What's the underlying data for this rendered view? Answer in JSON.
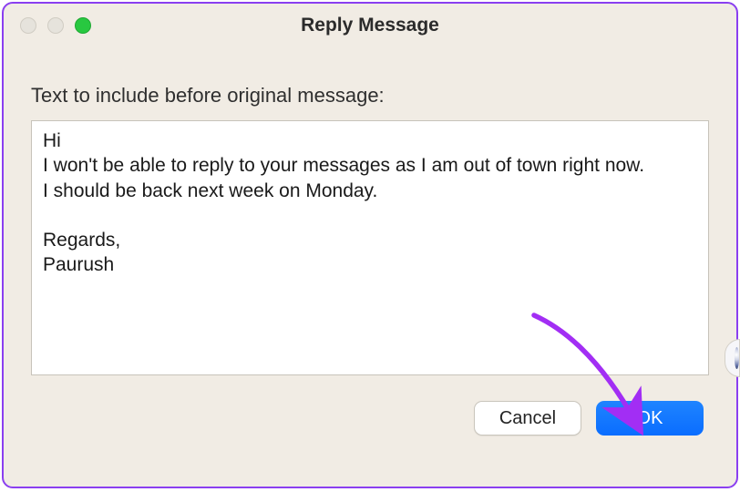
{
  "window": {
    "title": "Reply Message"
  },
  "dialog": {
    "label": "Text to include before original message:",
    "message": "Hi\nI won't be able to reply to your messages as I am out of town right now.\nI should be back next week on Monday.\n\nRegards,\nPaurush"
  },
  "buttons": {
    "cancel": "Cancel",
    "ok": "OK"
  },
  "colors": {
    "accent": "#0a6dff",
    "arrow": "#a22ef4"
  }
}
